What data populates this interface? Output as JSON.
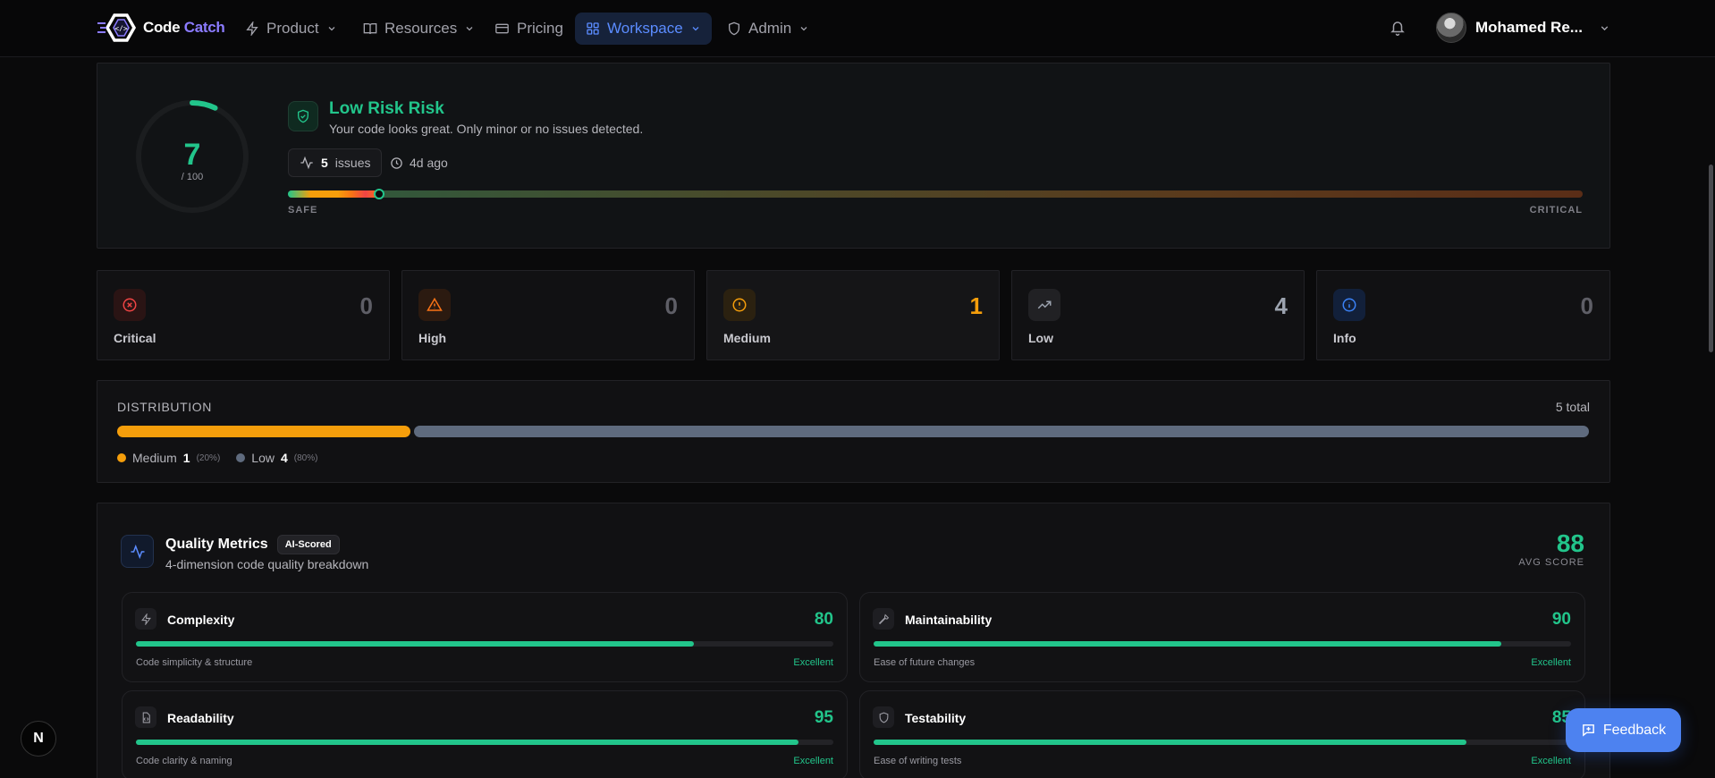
{
  "nav": {
    "brand_a": "Code",
    "brand_b": "Catch",
    "items": [
      {
        "label": "Product"
      },
      {
        "label": "Resources"
      },
      {
        "label": "Pricing"
      },
      {
        "label": "Workspace"
      },
      {
        "label": "Admin"
      }
    ],
    "user_name": "Mohamed Re..."
  },
  "risk": {
    "score": "7",
    "score_max": "/ 100",
    "score_value": 7,
    "title": "Low Risk Risk",
    "description": "Your code looks great. Only minor or no issues detected.",
    "issues_count": "5",
    "issues_label": "issues",
    "age": "4d ago",
    "scale_min": "SAFE",
    "scale_max": "CRITICAL",
    "accent": "#22c58b"
  },
  "severity": [
    {
      "name": "Critical",
      "count": "0",
      "color": "#ef4444"
    },
    {
      "name": "High",
      "count": "0",
      "color": "#f97316"
    },
    {
      "name": "Medium",
      "count": "1",
      "color": "#f59e0b"
    },
    {
      "name": "Low",
      "count": "4",
      "color": "#9ca3af"
    },
    {
      "name": "Info",
      "count": "0",
      "color": "#3b82f6"
    }
  ],
  "distribution": {
    "title": "DISTRIBUTION",
    "total": "5 total",
    "legend": [
      {
        "label": "Medium",
        "count": "1",
        "pct": "(20%)",
        "color": "#f59e0b"
      },
      {
        "label": "Low",
        "count": "4",
        "pct": "(80%)",
        "color": "#5f6b7e"
      }
    ]
  },
  "quality": {
    "title": "Quality Metrics",
    "badge": "AI-Scored",
    "subtitle": "4-dimension code quality breakdown",
    "avg": "88",
    "avg_label": "AVG SCORE",
    "metrics": [
      {
        "name": "Complexity",
        "score": "80",
        "desc": "Code simplicity & structure",
        "rating": "Excellent",
        "icon": "bolt-icon"
      },
      {
        "name": "Maintainability",
        "score": "90",
        "desc": "Ease of future changes",
        "rating": "Excellent",
        "icon": "wrench-icon"
      },
      {
        "name": "Readability",
        "score": "95",
        "desc": "Code clarity & naming",
        "rating": "Excellent",
        "icon": "file-code-icon"
      },
      {
        "name": "Testability",
        "score": "85",
        "desc": "Ease of writing tests",
        "rating": "Excellent",
        "icon": "shield-icon"
      }
    ]
  },
  "widgets": {
    "n_badge": "N",
    "feedback": "Feedback"
  }
}
